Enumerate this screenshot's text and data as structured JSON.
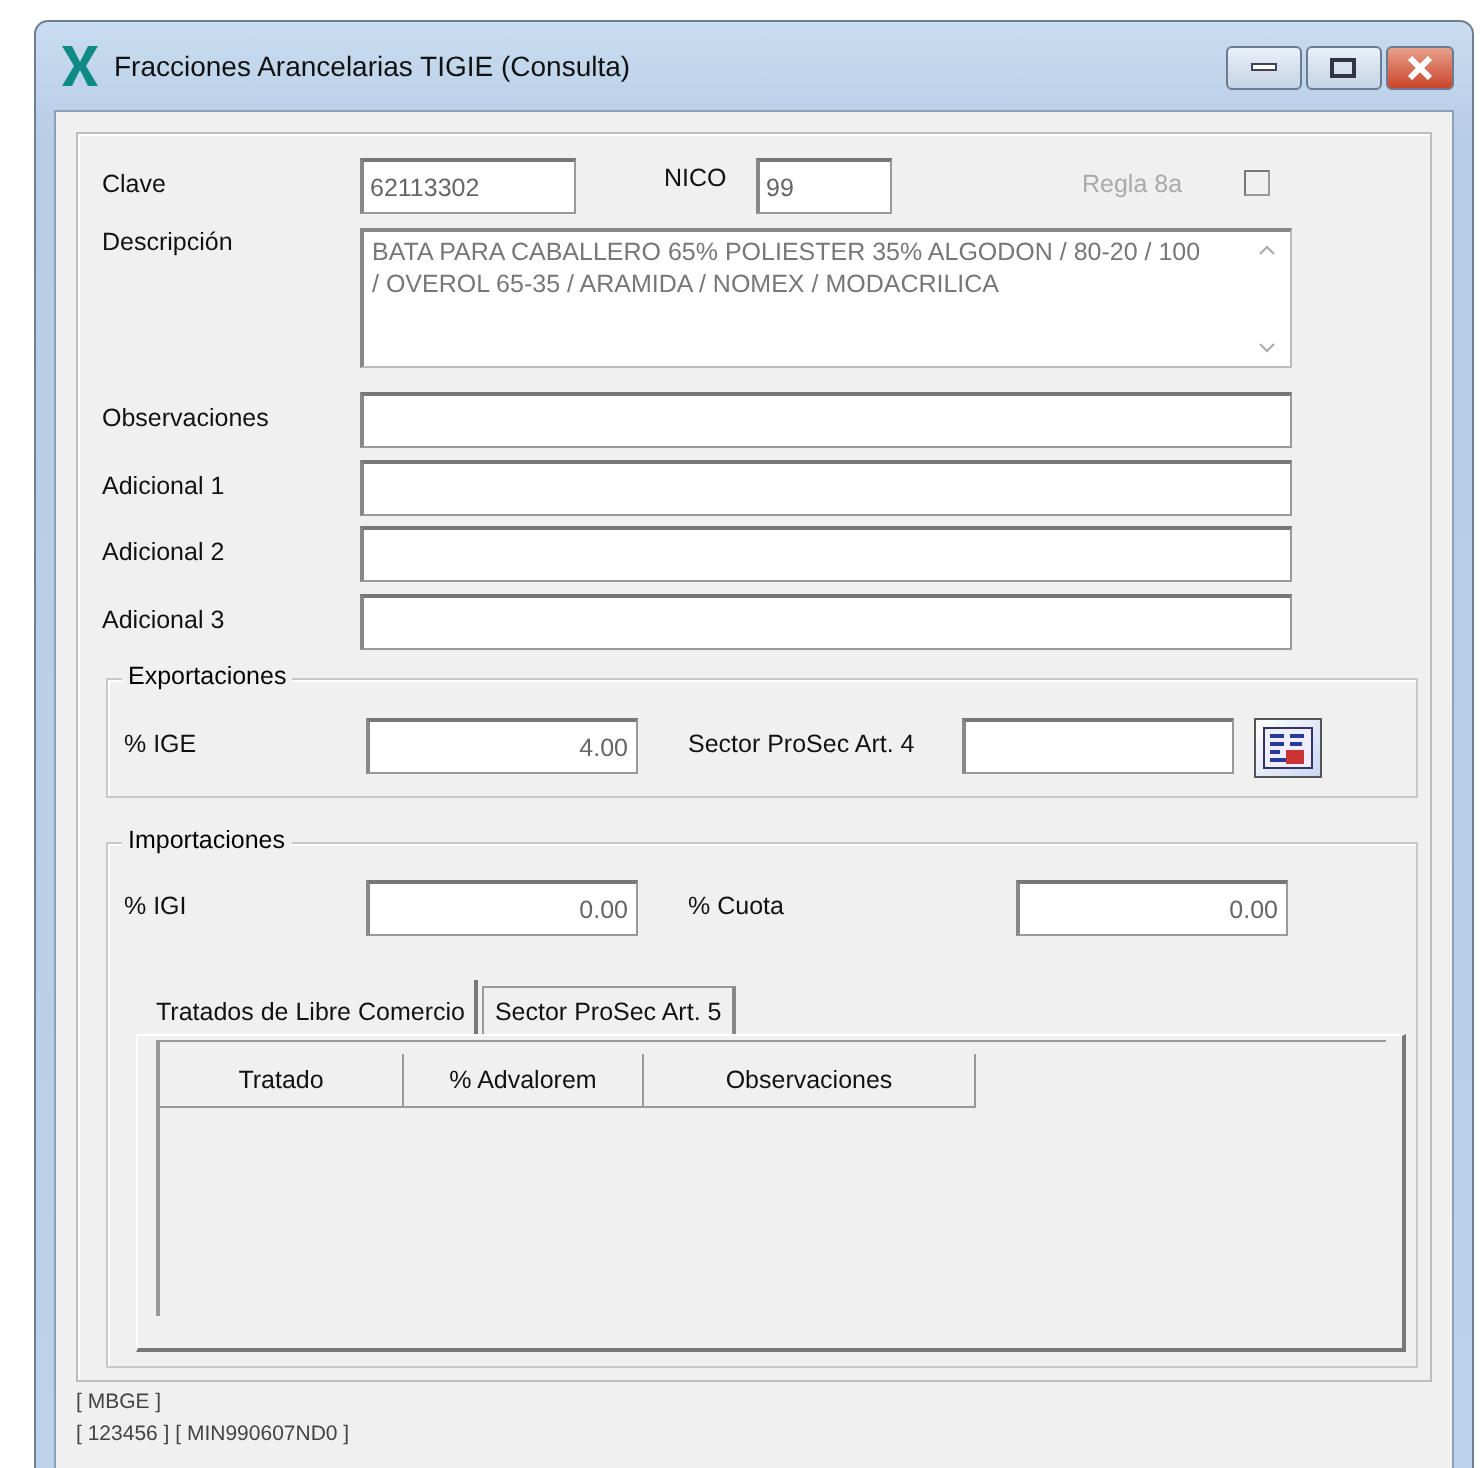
{
  "window": {
    "title": "Fracciones Arancelarias TIGIE (Consulta)"
  },
  "form": {
    "clave_label": "Clave",
    "clave": "62113302",
    "nico_label": "NICO",
    "nico": "99",
    "regla_label": "Regla 8a",
    "regla_checked": false,
    "regla_disabled": true,
    "descripcion_label": "Descripción",
    "descripcion": "BATA PARA CABALLERO 65% POLIESTER 35% ALGODON / 80-20 / 100 / OVEROL 65-35 / ARAMIDA / NOMEX / MODACRILICA",
    "fields": [
      {
        "label": "Observaciones"
      },
      {
        "label": "Adicional 1"
      },
      {
        "label": "Adicional 2"
      },
      {
        "label": "Adicional 3"
      }
    ]
  },
  "exportaciones": {
    "title": "Exportaciones",
    "ige_label": "% IGE",
    "ige": "4.00",
    "sector_label": "Sector ProSec Art. 4"
  },
  "importaciones": {
    "title": "Importaciones",
    "igi_label": "% IGI",
    "igi": "0.00",
    "cuota_label": "% Cuota",
    "cuota": "0.00",
    "tabs": [
      {
        "label": "Tratados de Libre Comercio",
        "selected": true
      },
      {
        "label": "Sector ProSec Art. 5",
        "selected": false
      }
    ],
    "table": {
      "columns": [
        "Tratado",
        "% Advalorem",
        "Observaciones"
      ]
    }
  },
  "status_bar": [
    "[ MBGE ]",
    "[ 123456 ]  [ MIN990607ND0 ]"
  ]
}
